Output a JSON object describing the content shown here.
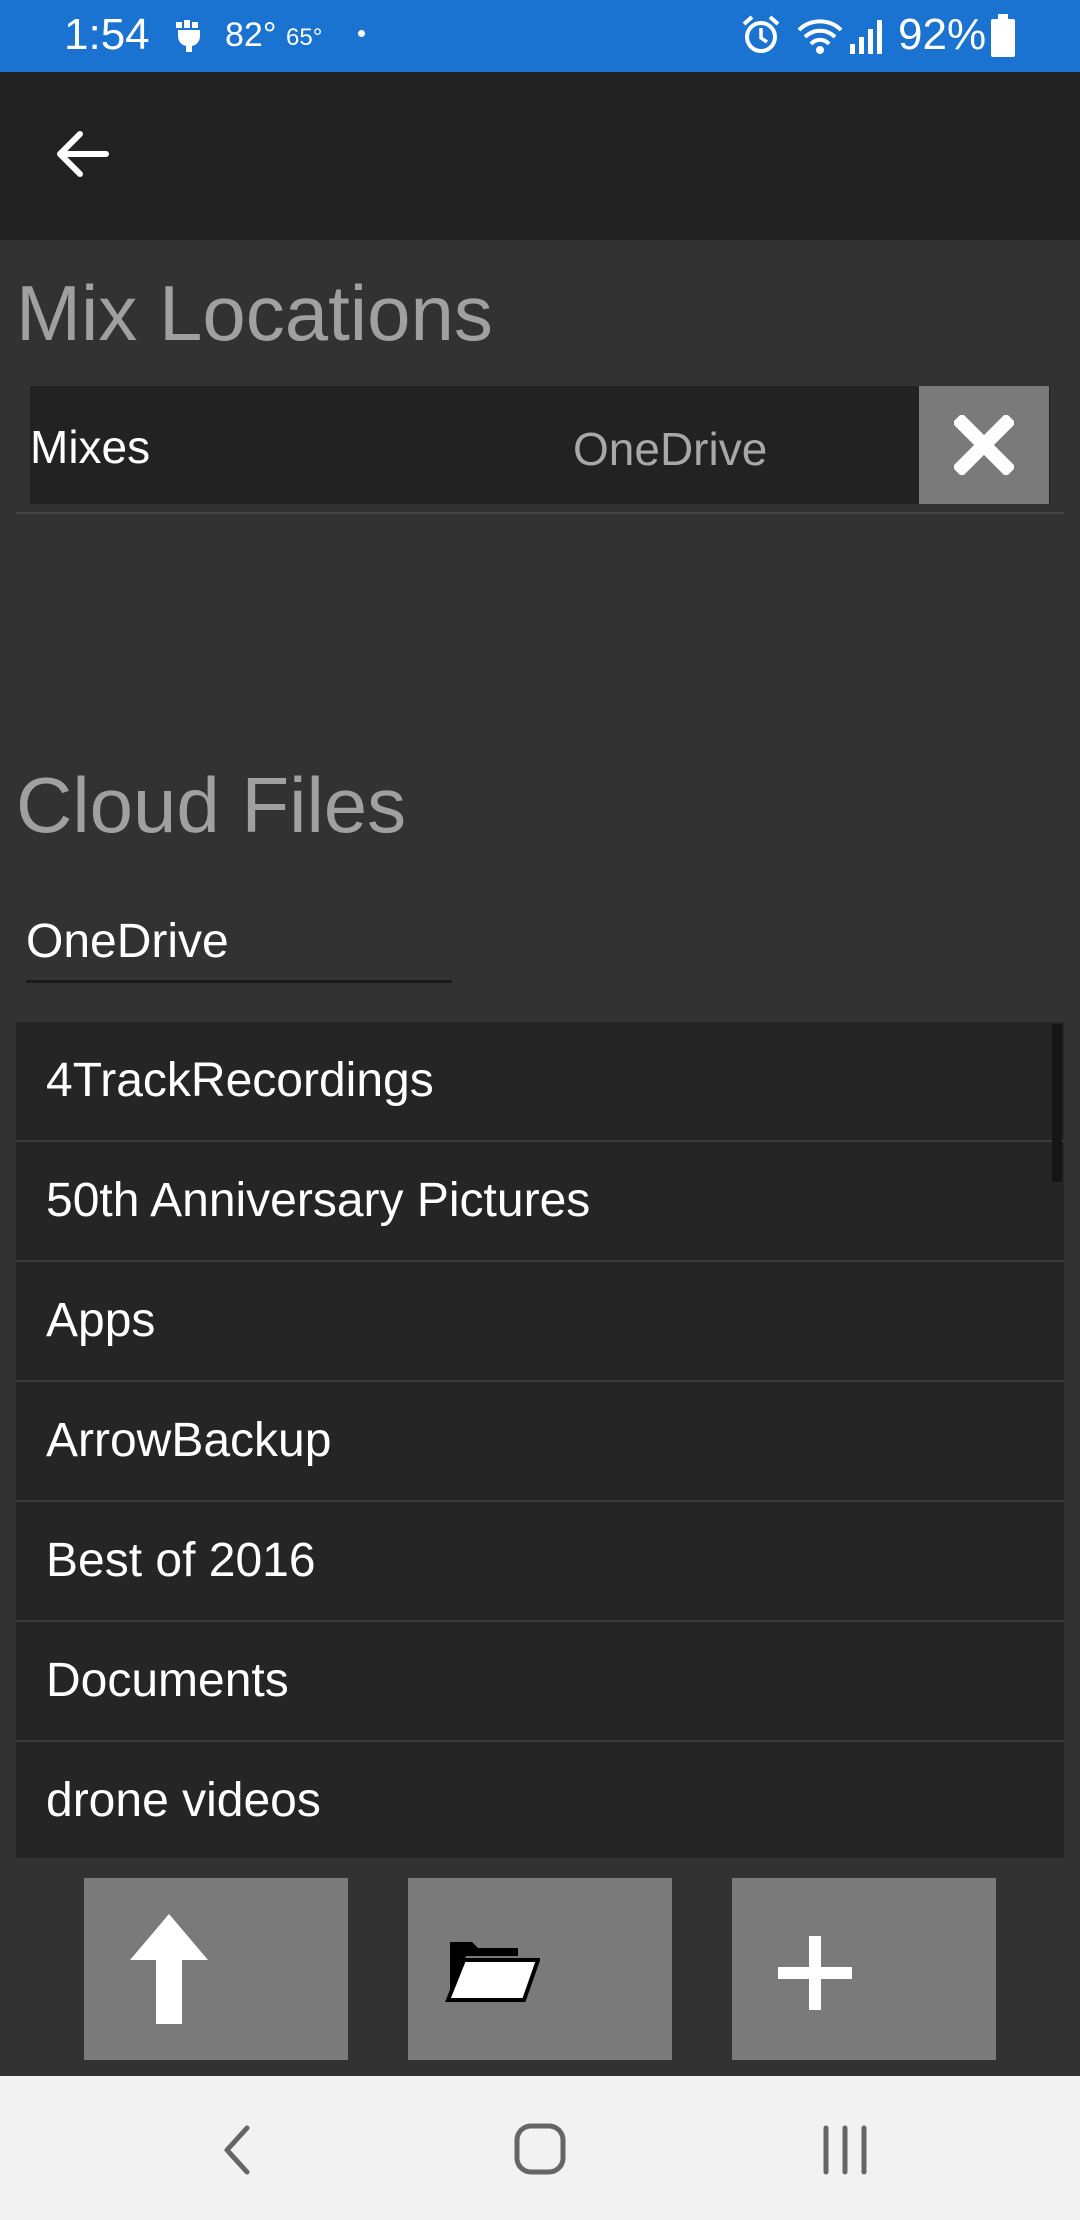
{
  "status_bar": {
    "time": "1:54",
    "temp_high": "82°",
    "temp_low": "65°",
    "battery": "92%",
    "color": "#1a73d0"
  },
  "app_bar": {
    "back_icon": "arrow-left-icon"
  },
  "mix_locations": {
    "title": "Mix Locations",
    "items": [
      {
        "name": "Mixes",
        "provider": "OneDrive"
      }
    ]
  },
  "cloud_files": {
    "title": "Cloud Files",
    "provider_value": "OneDrive",
    "folders": [
      "4TrackRecordings",
      "50th Anniversary Pictures",
      "Apps",
      "ArrowBackup",
      "Best of 2016",
      "Documents",
      "drone videos"
    ]
  },
  "toolbar": {
    "up_icon": "arrow-up-icon",
    "open_icon": "folder-open-icon",
    "add_icon": "plus-icon"
  },
  "nav_bar": {
    "back_icon": "nav-back-icon",
    "home_icon": "nav-home-icon",
    "recents_icon": "nav-recents-icon"
  }
}
